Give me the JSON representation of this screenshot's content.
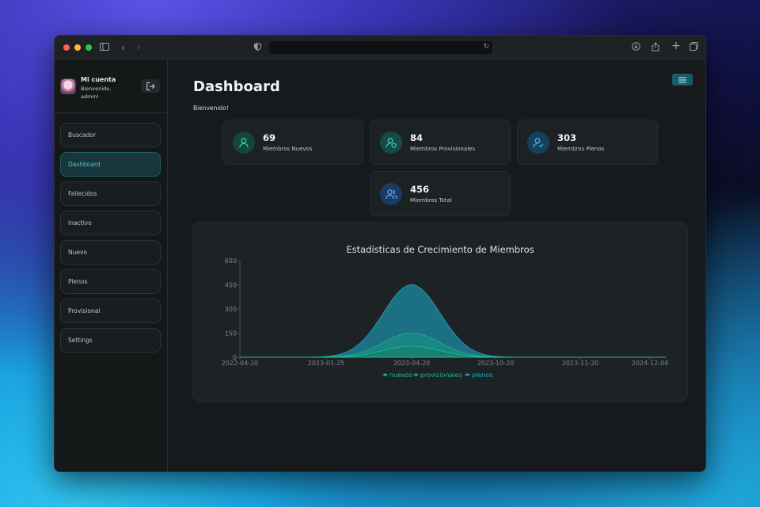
{
  "account": {
    "title": "Mi cuenta",
    "subtitle": "Bienvenido, admin!"
  },
  "nav": [
    {
      "label": "Buscador",
      "active": false
    },
    {
      "label": "Dashboard",
      "active": true
    },
    {
      "label": "Fallecidos",
      "active": false
    },
    {
      "label": "Inactivo",
      "active": false
    },
    {
      "label": "Nuevo",
      "active": false
    },
    {
      "label": "Plenos",
      "active": false
    },
    {
      "label": "Provisional",
      "active": false
    },
    {
      "label": "Settings",
      "active": false
    }
  ],
  "main": {
    "title": "Dashboard",
    "welcome": "Bienvenido!"
  },
  "stats": [
    {
      "value": "69",
      "label": "Miembros Nuevos",
      "icon": "user-icon",
      "color": "#1fc48f"
    },
    {
      "value": "84",
      "label": "Miembros Provisionales",
      "icon": "user-clock-icon",
      "color": "#1fbfa0"
    },
    {
      "value": "303",
      "label": "Miembros Plenos",
      "icon": "user-check-icon",
      "color": "#2aa6c6"
    },
    {
      "value": "456",
      "label": "Miembros Total",
      "icon": "users-icon",
      "color": "#3b8fe0"
    }
  ],
  "chart_data": {
    "type": "area",
    "title": "Estadísticas de Crecimiento de Miembros",
    "x_ticks": [
      "2022-04-20",
      "2023-01-25",
      "2023-04-20",
      "2023-10-20",
      "2023-11-20",
      "2024-12-04"
    ],
    "y_ticks": [
      0,
      150,
      300,
      450,
      600
    ],
    "ylim": [
      0,
      600
    ],
    "series": [
      {
        "name": "nuevos",
        "color": "#1fc48f",
        "peak_x": "2023-04-20",
        "peak_value": 69
      },
      {
        "name": "provisionales",
        "color": "#20b58c",
        "peak_x": "2023-04-20",
        "peak_value": 150
      },
      {
        "name": "plenos",
        "color": "#23a8c8",
        "peak_x": "2023-04-20",
        "peak_value": 450
      }
    ],
    "legend_position": "bottom"
  }
}
